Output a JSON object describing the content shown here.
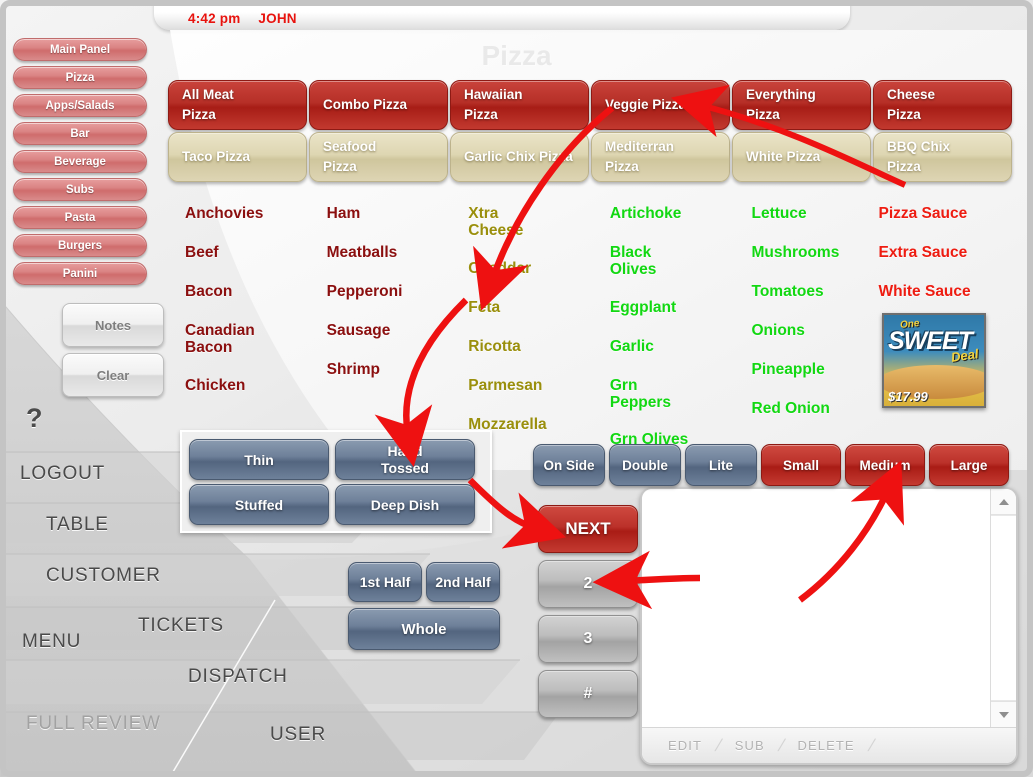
{
  "header": {
    "time": "4:42 pm",
    "user": "JOHN"
  },
  "page_title": "Pizza",
  "sidebar_categories": [
    {
      "label": "Main Panel"
    },
    {
      "label": "Pizza"
    },
    {
      "label": "Apps/Salads"
    },
    {
      "label": "Bar"
    },
    {
      "label": "Beverage"
    },
    {
      "label": "Subs"
    },
    {
      "label": "Pasta"
    },
    {
      "label": "Burgers"
    },
    {
      "label": "Panini"
    }
  ],
  "utility_buttons": [
    {
      "label": "Notes"
    },
    {
      "label": "Clear"
    }
  ],
  "help_glyph": "?",
  "nav_labels": {
    "logout": "LOGOUT",
    "table": "TABLE",
    "customer": "CUSTOMER",
    "menu": "MENU",
    "full_review": "FULL REVIEW",
    "tickets": "TICKETS",
    "dispatch": "DISPATCH",
    "user": "USER"
  },
  "pizza_types": {
    "row1": [
      {
        "line1": "All Meat",
        "line2": "Pizza",
        "style": "red"
      },
      {
        "line1": "Combo Pizza",
        "line2": "",
        "style": "red"
      },
      {
        "line1": "Hawaiian",
        "line2": "Pizza",
        "style": "red"
      },
      {
        "line1": "Veggie Pizza",
        "line2": "",
        "style": "red"
      },
      {
        "line1": "Everything",
        "line2": "Pizza",
        "style": "red"
      },
      {
        "line1": "Cheese",
        "line2": "Pizza",
        "style": "red"
      }
    ],
    "row2": [
      {
        "line1": "Taco Pizza",
        "line2": "",
        "style": "tan"
      },
      {
        "line1": "Seafood",
        "line2": "Pizza",
        "style": "tan"
      },
      {
        "line1": "Garlic Chix Pizza",
        "line2": "",
        "style": "tan"
      },
      {
        "line1": "Mediterran",
        "line2": "Pizza",
        "style": "tan"
      },
      {
        "line1": "White Pizza",
        "line2": "",
        "style": "tan"
      },
      {
        "line1": "BBQ Chix",
        "line2": "Pizza",
        "style": "tan"
      }
    ]
  },
  "toppings": {
    "meat_col1": [
      "Anchovies",
      "Beef",
      "Bacon",
      "Canadian Bacon",
      "Chicken"
    ],
    "meat_col2": [
      "Ham",
      "Meatballs",
      "Pepperoni",
      "Sausage",
      "Shrimp"
    ],
    "cheese_col": [
      "Xtra Cheese",
      "Cheddar",
      "Feta",
      "Ricotta",
      "Parmesan",
      "Mozzarella"
    ],
    "veg_col1": [
      "Artichoke",
      "Black Olives",
      "Eggplant",
      "Garlic",
      "Grn Peppers",
      "Grn Olives"
    ],
    "veg_col2": [
      "Lettuce",
      "Mushrooms",
      "Tomatoes",
      "Onions",
      "Pineapple",
      "Red Onion"
    ],
    "sauce_col": [
      "Pizza Sauce",
      "Extra Sauce",
      "White Sauce"
    ]
  },
  "promo_ad": {
    "line_one": "One",
    "line_sweet": "SWEET",
    "line_deal": "Deal",
    "price": "$17.99"
  },
  "crust_options": [
    {
      "line1": "Thin",
      "line2": ""
    },
    {
      "line1": "Hand",
      "line2": "Tossed"
    },
    {
      "line1": "Stuffed",
      "line2": ""
    },
    {
      "line1": "Deep Dish",
      "line2": ""
    }
  ],
  "portion_options": {
    "first_half": "1st Half",
    "second_half": "2nd Half",
    "whole": "Whole"
  },
  "modifiers": [
    {
      "label": "On Side",
      "style": "blue"
    },
    {
      "label": "Double",
      "style": "blue"
    },
    {
      "label": "Lite",
      "style": "blue"
    }
  ],
  "sizes": [
    {
      "label": "Small",
      "style": "red"
    },
    {
      "label": "Medium",
      "style": "red"
    },
    {
      "label": "Large",
      "style": "red"
    }
  ],
  "numpad": [
    {
      "label": "NEXT",
      "style": "red"
    },
    {
      "label": "2",
      "style": "gray"
    },
    {
      "label": "3",
      "style": "gray"
    },
    {
      "label": "#",
      "style": "gray"
    }
  ],
  "order_panel": {
    "items": [],
    "actions": [
      "EDIT",
      "SUB",
      "DELETE"
    ],
    "action_separator": "/",
    "scroll_up_icon": "triangle-up-icon",
    "scroll_down_icon": "triangle-down-icon"
  },
  "annotation": {
    "color": "#ee1111",
    "steps": [
      "Veggie Pizza",
      "Feta",
      "Hand Tossed",
      "NEXT",
      "2",
      "Medium"
    ]
  }
}
